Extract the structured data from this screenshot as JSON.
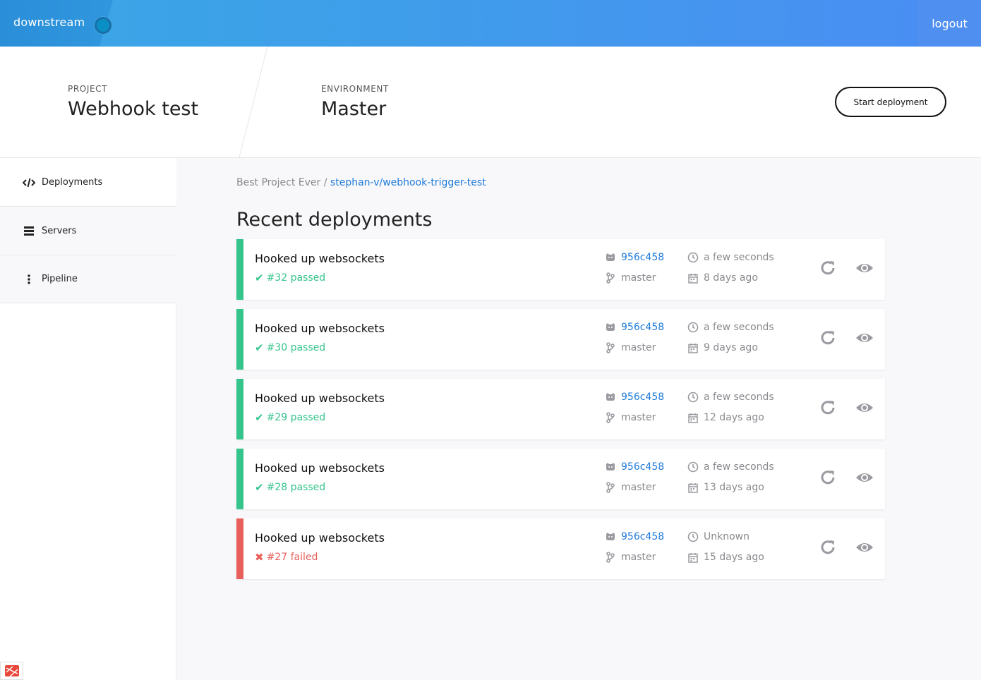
{
  "topbar": {
    "brand": "downstream",
    "logout_label": "logout"
  },
  "header": {
    "project_label": "PROJECT",
    "project_name": "Webhook test",
    "environment_label": "ENVIRONMENT",
    "environment_name": "Master",
    "start_button": "Start deployment"
  },
  "sidebar": {
    "items": [
      {
        "label": "Deployments",
        "icon": "code-icon"
      },
      {
        "label": "Servers",
        "icon": "servers-icon"
      },
      {
        "label": "Pipeline",
        "icon": "pipeline-icon"
      }
    ]
  },
  "breadcrumb": {
    "parent": "Best Project Ever /",
    "current": "stephan-v/webhook-trigger-test"
  },
  "main": {
    "title": "Recent deployments"
  },
  "deployments": [
    {
      "title": "Hooked up websockets",
      "result": "#32 passed",
      "status": "passed",
      "commit": "956c458",
      "branch": "master",
      "duration": "a few seconds",
      "date": "8 days ago"
    },
    {
      "title": "Hooked up websockets",
      "result": "#30 passed",
      "status": "passed",
      "commit": "956c458",
      "branch": "master",
      "duration": "a few seconds",
      "date": "9 days ago"
    },
    {
      "title": "Hooked up websockets",
      "result": "#29 passed",
      "status": "passed",
      "commit": "956c458",
      "branch": "master",
      "duration": "a few seconds",
      "date": "12 days ago"
    },
    {
      "title": "Hooked up websockets",
      "result": "#28 passed",
      "status": "passed",
      "commit": "956c458",
      "branch": "master",
      "duration": "a few seconds",
      "date": "13 days ago"
    },
    {
      "title": "Hooked up websockets",
      "result": "#27 failed",
      "status": "failed",
      "commit": "956c458",
      "branch": "master",
      "duration": "Unknown",
      "date": "15 days ago"
    }
  ],
  "colors": {
    "passed": "#35c48c",
    "failed": "#e8605c",
    "link": "#1e7ad9"
  }
}
